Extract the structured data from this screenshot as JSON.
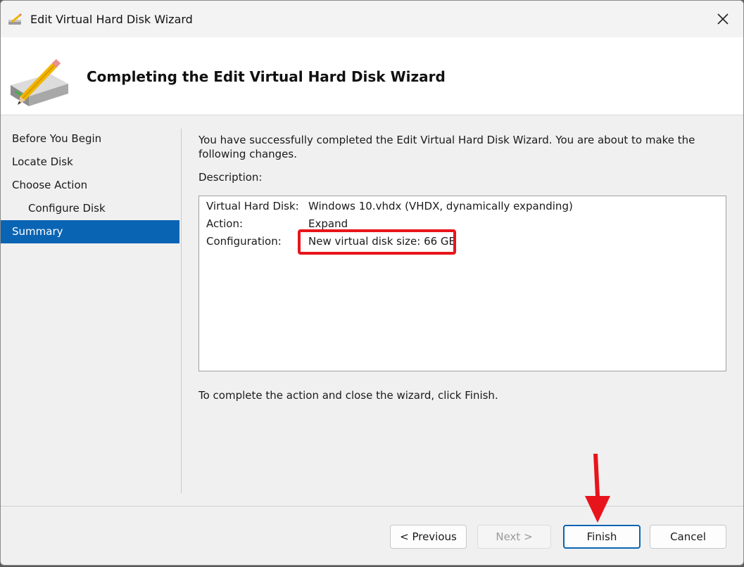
{
  "window": {
    "title": "Edit Virtual Hard Disk Wizard"
  },
  "header": {
    "title": "Completing the Edit Virtual Hard Disk Wizard"
  },
  "nav": {
    "items": [
      {
        "label": "Before You Begin"
      },
      {
        "label": "Locate Disk"
      },
      {
        "label": "Choose Action"
      },
      {
        "label": "Configure Disk"
      },
      {
        "label": "Summary"
      }
    ]
  },
  "content": {
    "intro": "You have successfully completed the Edit Virtual Hard Disk Wizard. You are about to make the following changes.",
    "description_label": "Description:",
    "rows": [
      {
        "key": "Virtual Hard Disk:",
        "value": "Windows 10.vhdx (VHDX, dynamically expanding)"
      },
      {
        "key": "Action:",
        "value": "Expand"
      },
      {
        "key": "Configuration:",
        "value": "New virtual disk size: 66 GB"
      }
    ],
    "finish_note": "To complete the action and close the wizard, click Finish."
  },
  "buttons": {
    "previous": "< Previous",
    "next": "Next >",
    "finish": "Finish",
    "cancel": "Cancel"
  },
  "colors": {
    "accent": "#0a64b4",
    "highlight": "#e8141b"
  }
}
